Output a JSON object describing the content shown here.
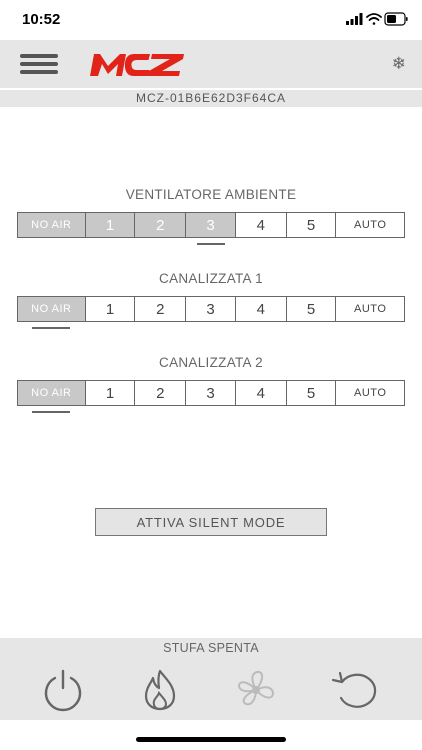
{
  "status_bar": {
    "time": "10:52"
  },
  "header": {
    "logo_text": "MCZ"
  },
  "device": {
    "id": "MCZ-01B6E62D3F64CA"
  },
  "fans": [
    {
      "title": "VENTILATORE AMBIENTE",
      "options": [
        "NO AIR",
        "1",
        "2",
        "3",
        "4",
        "5",
        "AUTO"
      ],
      "selected": "3"
    },
    {
      "title": "CANALIZZATA 1",
      "options": [
        "NO AIR",
        "1",
        "2",
        "3",
        "4",
        "5",
        "AUTO"
      ],
      "selected": "NO AIR"
    },
    {
      "title": "CANALIZZATA 2",
      "options": [
        "NO AIR",
        "1",
        "2",
        "3",
        "4",
        "5",
        "AUTO"
      ],
      "selected": "NO AIR"
    }
  ],
  "silent_button": {
    "label": "ATTIVA SILENT MODE"
  },
  "stove_status": "STUFA SPENTA",
  "colors": {
    "accent": "#e2231a",
    "selected": "#c8c8c8",
    "bar": "#e6e6e6"
  },
  "icons": [
    "menu-icon",
    "snowflake-icon",
    "power-icon",
    "flame-icon",
    "fan-icon",
    "refresh-icon"
  ]
}
